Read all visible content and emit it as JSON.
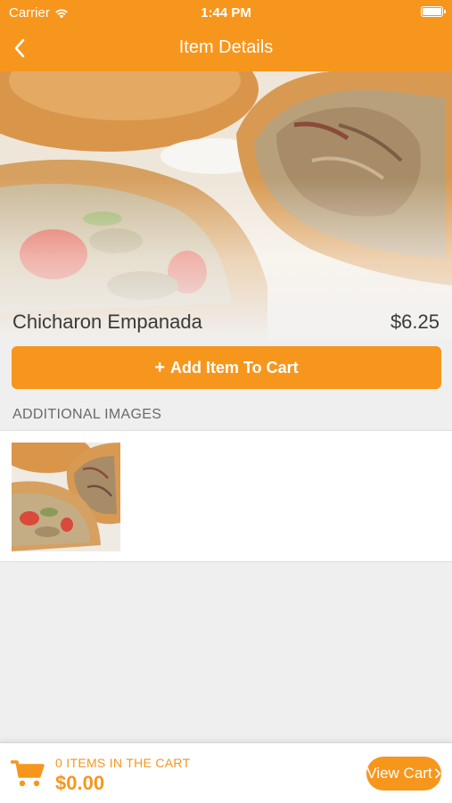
{
  "status_bar": {
    "carrier": "Carrier",
    "time": "1:44 PM"
  },
  "nav": {
    "title": "Item Details",
    "back_icon": "chevron-left-icon"
  },
  "item": {
    "name": "Chicharon Empanada",
    "price": "$6.25",
    "add_button_label": "Add Item To Cart",
    "add_button_icon": "plus"
  },
  "additional_images": {
    "header": "ADDITIONAL IMAGES",
    "count": 1
  },
  "cart": {
    "items_label": "0 ITEMS IN THE CART",
    "total": "$0.00",
    "view_cart_label": "View Cart",
    "view_cart_icon": "chevron-right",
    "cart_icon": "shopping-cart-icon"
  },
  "colors": {
    "accent": "#f7961d",
    "background": "#efefef",
    "text": "#3a3a3a"
  }
}
